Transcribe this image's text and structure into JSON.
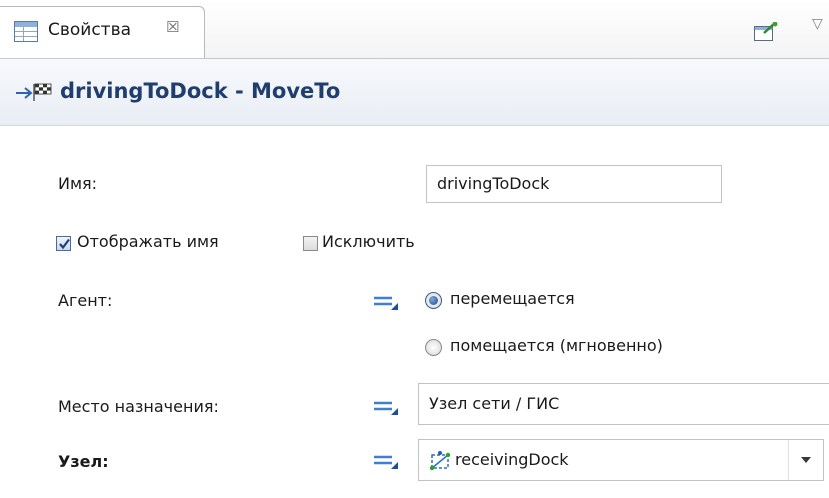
{
  "tab": {
    "label": "Свойства",
    "close_glyph": "☒"
  },
  "toolbar": {
    "menu_glyph": "▽"
  },
  "header": {
    "title": "drivingToDock - MoveTo"
  },
  "form": {
    "name_label": "Имя:",
    "name_value": "drivingToDock",
    "show_name_label": "Отображать имя",
    "show_name_checked": true,
    "exclude_label": "Исключить",
    "exclude_checked": false,
    "agent_label": "Агент:",
    "agent_options": [
      "перемещается",
      "помещается (мгновенно)"
    ],
    "agent_selected": "перемещается",
    "destination_label": "Место назначения:",
    "destination_value": "Узел сети / ГИС",
    "node_label": "Узел:",
    "node_value": "receivingDock"
  },
  "icons": {
    "tab": "properties-table-icon",
    "pin": "pin-view-icon",
    "menu": "view-menu-icon",
    "header": "moveto-flag-icon",
    "dynamic": "dynamic-value-icon",
    "node": "network-node-icon",
    "dropdown": "chevron-down-icon"
  },
  "colors": {
    "header_title": "#1f3e6e",
    "header_bg": "#e9eef5",
    "accent_icon": "#2b7a2b"
  }
}
